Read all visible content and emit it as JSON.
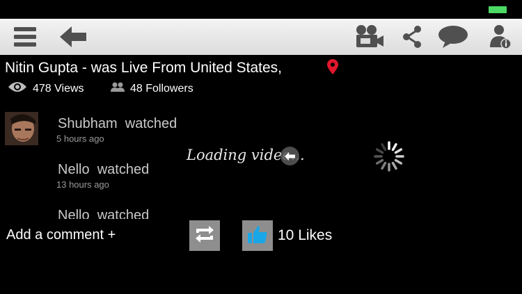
{
  "header": {
    "title": "Nitin Gupta - was Live From United States,",
    "views": "478 Views",
    "followers": "48 Followers"
  },
  "toolbar": {
    "icons": [
      "menu-icon",
      "back-arrow-icon",
      "video-camera-icon",
      "share-icon",
      "chat-bubble-icon",
      "user-info-icon"
    ]
  },
  "watchers": [
    {
      "name": "Shubham",
      "action": "watched",
      "time": "5 hours ago"
    },
    {
      "name": "Nello",
      "action": "watched",
      "time": "13 hours ago"
    },
    {
      "name": "Nello",
      "action": "watched",
      "time": ""
    }
  ],
  "video": {
    "loading_text": "Loading video..."
  },
  "footer": {
    "comment_label": "Add a comment +",
    "likes": "10 Likes"
  },
  "colors": {
    "pin": "#e0182d",
    "like": "#1aa7e8",
    "battery": "#4cd964"
  }
}
